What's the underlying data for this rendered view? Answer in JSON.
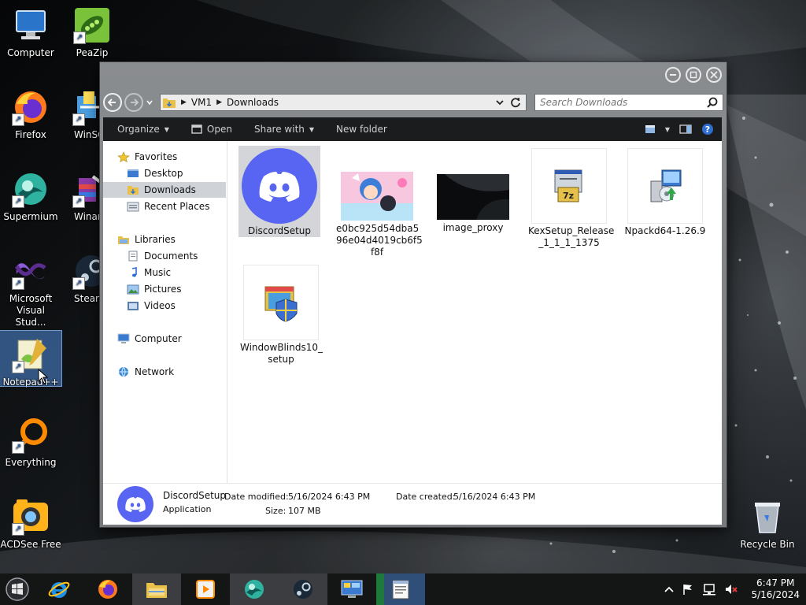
{
  "desktop": {
    "icons": [
      {
        "label": "Computer",
        "icon": "computer-icon"
      },
      {
        "label": "PeaZip",
        "icon": "peazip-icon"
      },
      {
        "label": "Firefox",
        "icon": "firefox-icon"
      },
      {
        "label": "WinSC",
        "icon": "winscp-icon"
      },
      {
        "label": "Supermium",
        "icon": "supermium-icon"
      },
      {
        "label": "Winar",
        "icon": "winrar-icon"
      },
      {
        "label": "Microsoft Visual Stud...",
        "icon": "visual-studio-icon"
      },
      {
        "label": "Stean",
        "icon": "steam-icon"
      },
      {
        "label": "Notepad++",
        "icon": "notepadpp-icon"
      },
      {
        "label": "Everything",
        "icon": "everything-icon"
      },
      {
        "label": "ACDSee Free",
        "icon": "acdsee-icon"
      },
      {
        "label": "Recycle Bin",
        "icon": "recycle-bin-icon"
      }
    ]
  },
  "explorer": {
    "address": {
      "root": "VM1",
      "folder": "Downloads"
    },
    "search_placeholder": "Search Downloads",
    "toolbar": {
      "organize": "Organize",
      "open": "Open",
      "share_with": "Share with",
      "new_folder": "New folder"
    },
    "nav": {
      "favorites": "Favorites",
      "desktop": "Desktop",
      "downloads": "Downloads",
      "recent": "Recent Places",
      "libraries": "Libraries",
      "documents": "Documents",
      "music": "Music",
      "pictures": "Pictures",
      "videos": "Videos",
      "computer": "Computer",
      "network": "Network"
    },
    "files": [
      {
        "line1": "DiscordSetup",
        "line2": "",
        "line3": ""
      },
      {
        "line1": "e0bc925d54dba5",
        "line2": "96e04d4019cb6f5",
        "line3": "f8f"
      },
      {
        "line1": "image_proxy",
        "line2": "",
        "line3": ""
      },
      {
        "line1": "KexSetup_Release",
        "line2": "_1_1_1_1375",
        "line3": ""
      },
      {
        "line1": "Npackd64-1.26.9",
        "line2": "",
        "line3": ""
      },
      {
        "line1": "WindowBlinds10_",
        "line2": "setup",
        "line3": ""
      }
    ],
    "details": {
      "name": "DiscordSetup",
      "type": "Application",
      "date_modified_label": "Date modified:",
      "date_modified": "5/16/2024 6:43 PM",
      "date_created_label": "Date created:",
      "date_created": "5/16/2024 6:43 PM",
      "size_label": "Size:",
      "size": "107 MB"
    }
  },
  "taskbar": {
    "time": "6:47 PM",
    "date": "5/16/2024"
  },
  "colors": {
    "discord": "#5865F2",
    "selection": "#d3d5d8",
    "toolbar": "#1b1c1e"
  }
}
